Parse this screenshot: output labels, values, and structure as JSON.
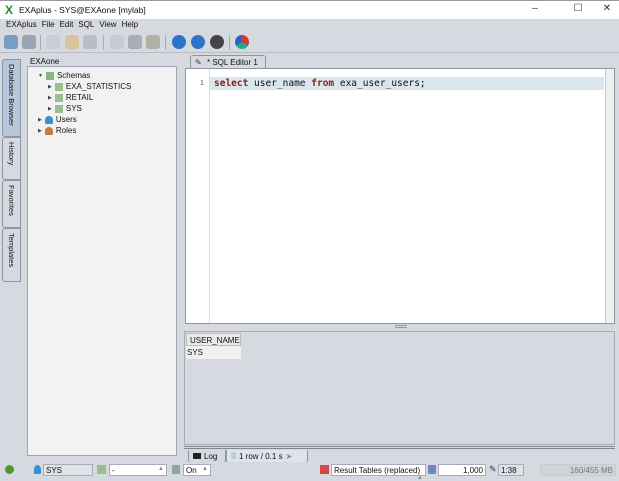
{
  "window": {
    "title": "EXAplus - SYS@EXAone [mylab]",
    "controls": [
      "minimize",
      "maximize",
      "close"
    ]
  },
  "menu": [
    "EXAplus",
    "File",
    "Edit",
    "SQL",
    "View",
    "Help"
  ],
  "toolbar": [
    "connect",
    "disconnect",
    "new-sql",
    "open",
    "save",
    "cut",
    "copy",
    "paste",
    "execute",
    "execute-current",
    "stop",
    "autocommit"
  ],
  "side_tabs": [
    "Database Browser",
    "History",
    "Favorites",
    "Templates"
  ],
  "browser": {
    "connection": "EXAone",
    "tree": {
      "schemas_label": "Schemas",
      "schemas": [
        "EXA_STATISTICS",
        "RETAIL",
        "SYS"
      ],
      "users": "Users",
      "roles": "Roles"
    }
  },
  "editor": {
    "tab_label": "* SQL Editor 1",
    "line_number": "1",
    "code": [
      {
        "t": "select",
        "kw": true
      },
      {
        "t": " user_name ",
        "kw": false
      },
      {
        "t": "from",
        "kw": true
      },
      {
        "t": " exa_user_users;",
        "kw": false
      }
    ]
  },
  "results": {
    "columns": [
      "USER_NAME"
    ],
    "rows": [
      [
        "SYS"
      ]
    ]
  },
  "bottom_tabs": {
    "log": "Log",
    "result": "1 row / 0.1 s"
  },
  "status": {
    "user": "SYS",
    "schema": "-",
    "autocommit": "On",
    "result_mode": "Result Tables (replaced)",
    "max_rows": "1,000",
    "cursor": "1:38",
    "memory": "160/455 MB"
  }
}
